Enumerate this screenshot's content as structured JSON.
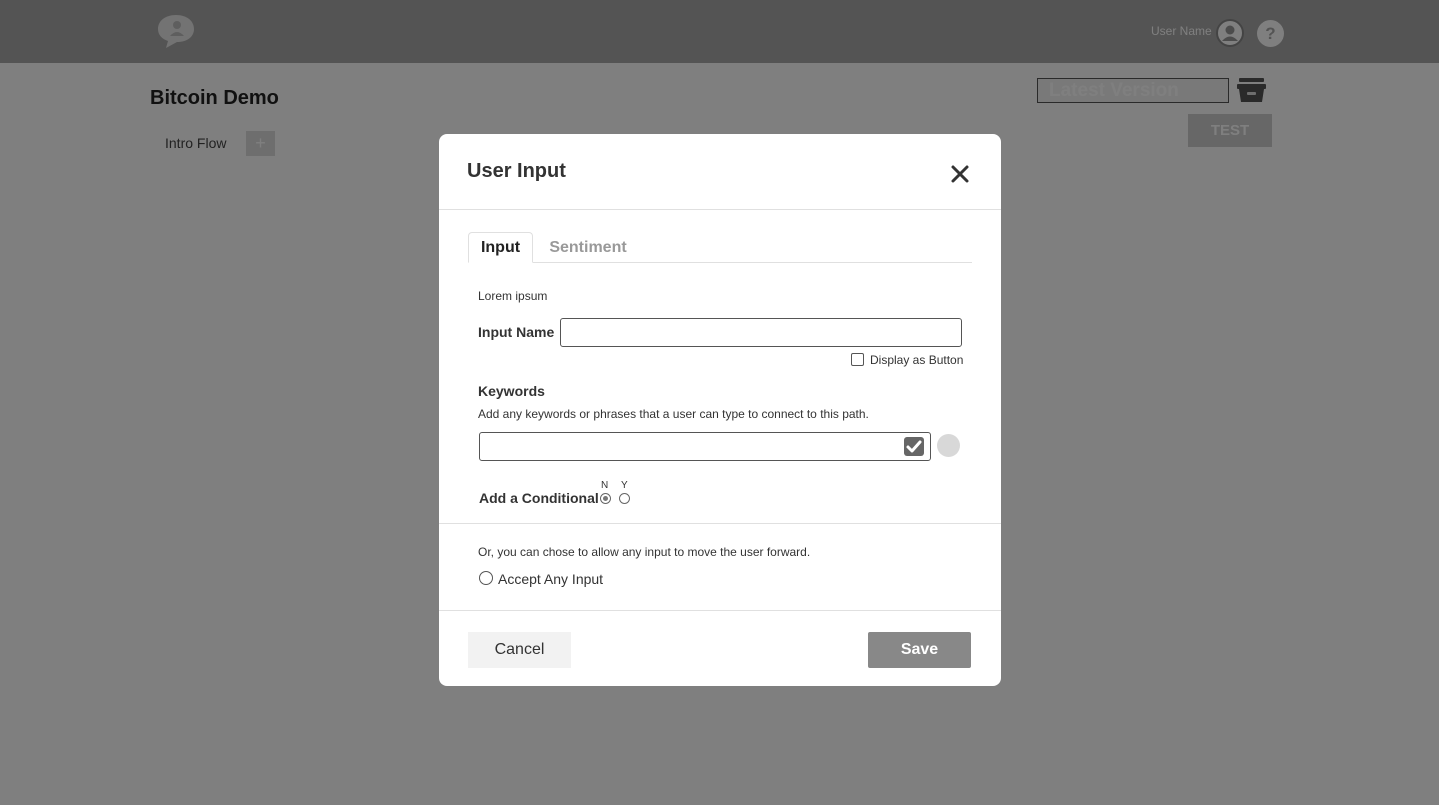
{
  "header": {
    "logo_icon": "speech-bubble-logo",
    "user_name": "User Name",
    "user_icon": "user-avatar-icon",
    "help_label": "?"
  },
  "page": {
    "title": "Bitcoin Demo",
    "flow_tab": "Intro Flow",
    "add_flow_label": "+",
    "version_value": "Latest Version",
    "archive_icon": "archive-icon",
    "test_label": "TEST"
  },
  "modal": {
    "title": "User Input",
    "close_icon": "close-icon",
    "tabs": [
      {
        "label": "Input",
        "active": true
      },
      {
        "label": "Sentiment",
        "active": false
      }
    ],
    "description": "Lorem ipsum",
    "input_name_label": "Input Name",
    "input_name_value": "",
    "display_as_button_label": "Display as Button",
    "display_as_button_checked": false,
    "keywords_heading": "Keywords",
    "keywords_help": "Add any keywords or phrases that a user can type to connect to this path.",
    "keywords_value": "",
    "conditional_label": "Add a Conditional",
    "conditional_options": [
      "N",
      "Y"
    ],
    "conditional_selected": "N",
    "or_text": "Or, you can chose to allow any input to move the user forward.",
    "accept_any_label": "Accept Any Input",
    "cancel_label": "Cancel",
    "save_label": "Save"
  },
  "colors": {
    "overlay": "#000000",
    "save_button": "#888888",
    "topbar": "#a9a9a9"
  }
}
